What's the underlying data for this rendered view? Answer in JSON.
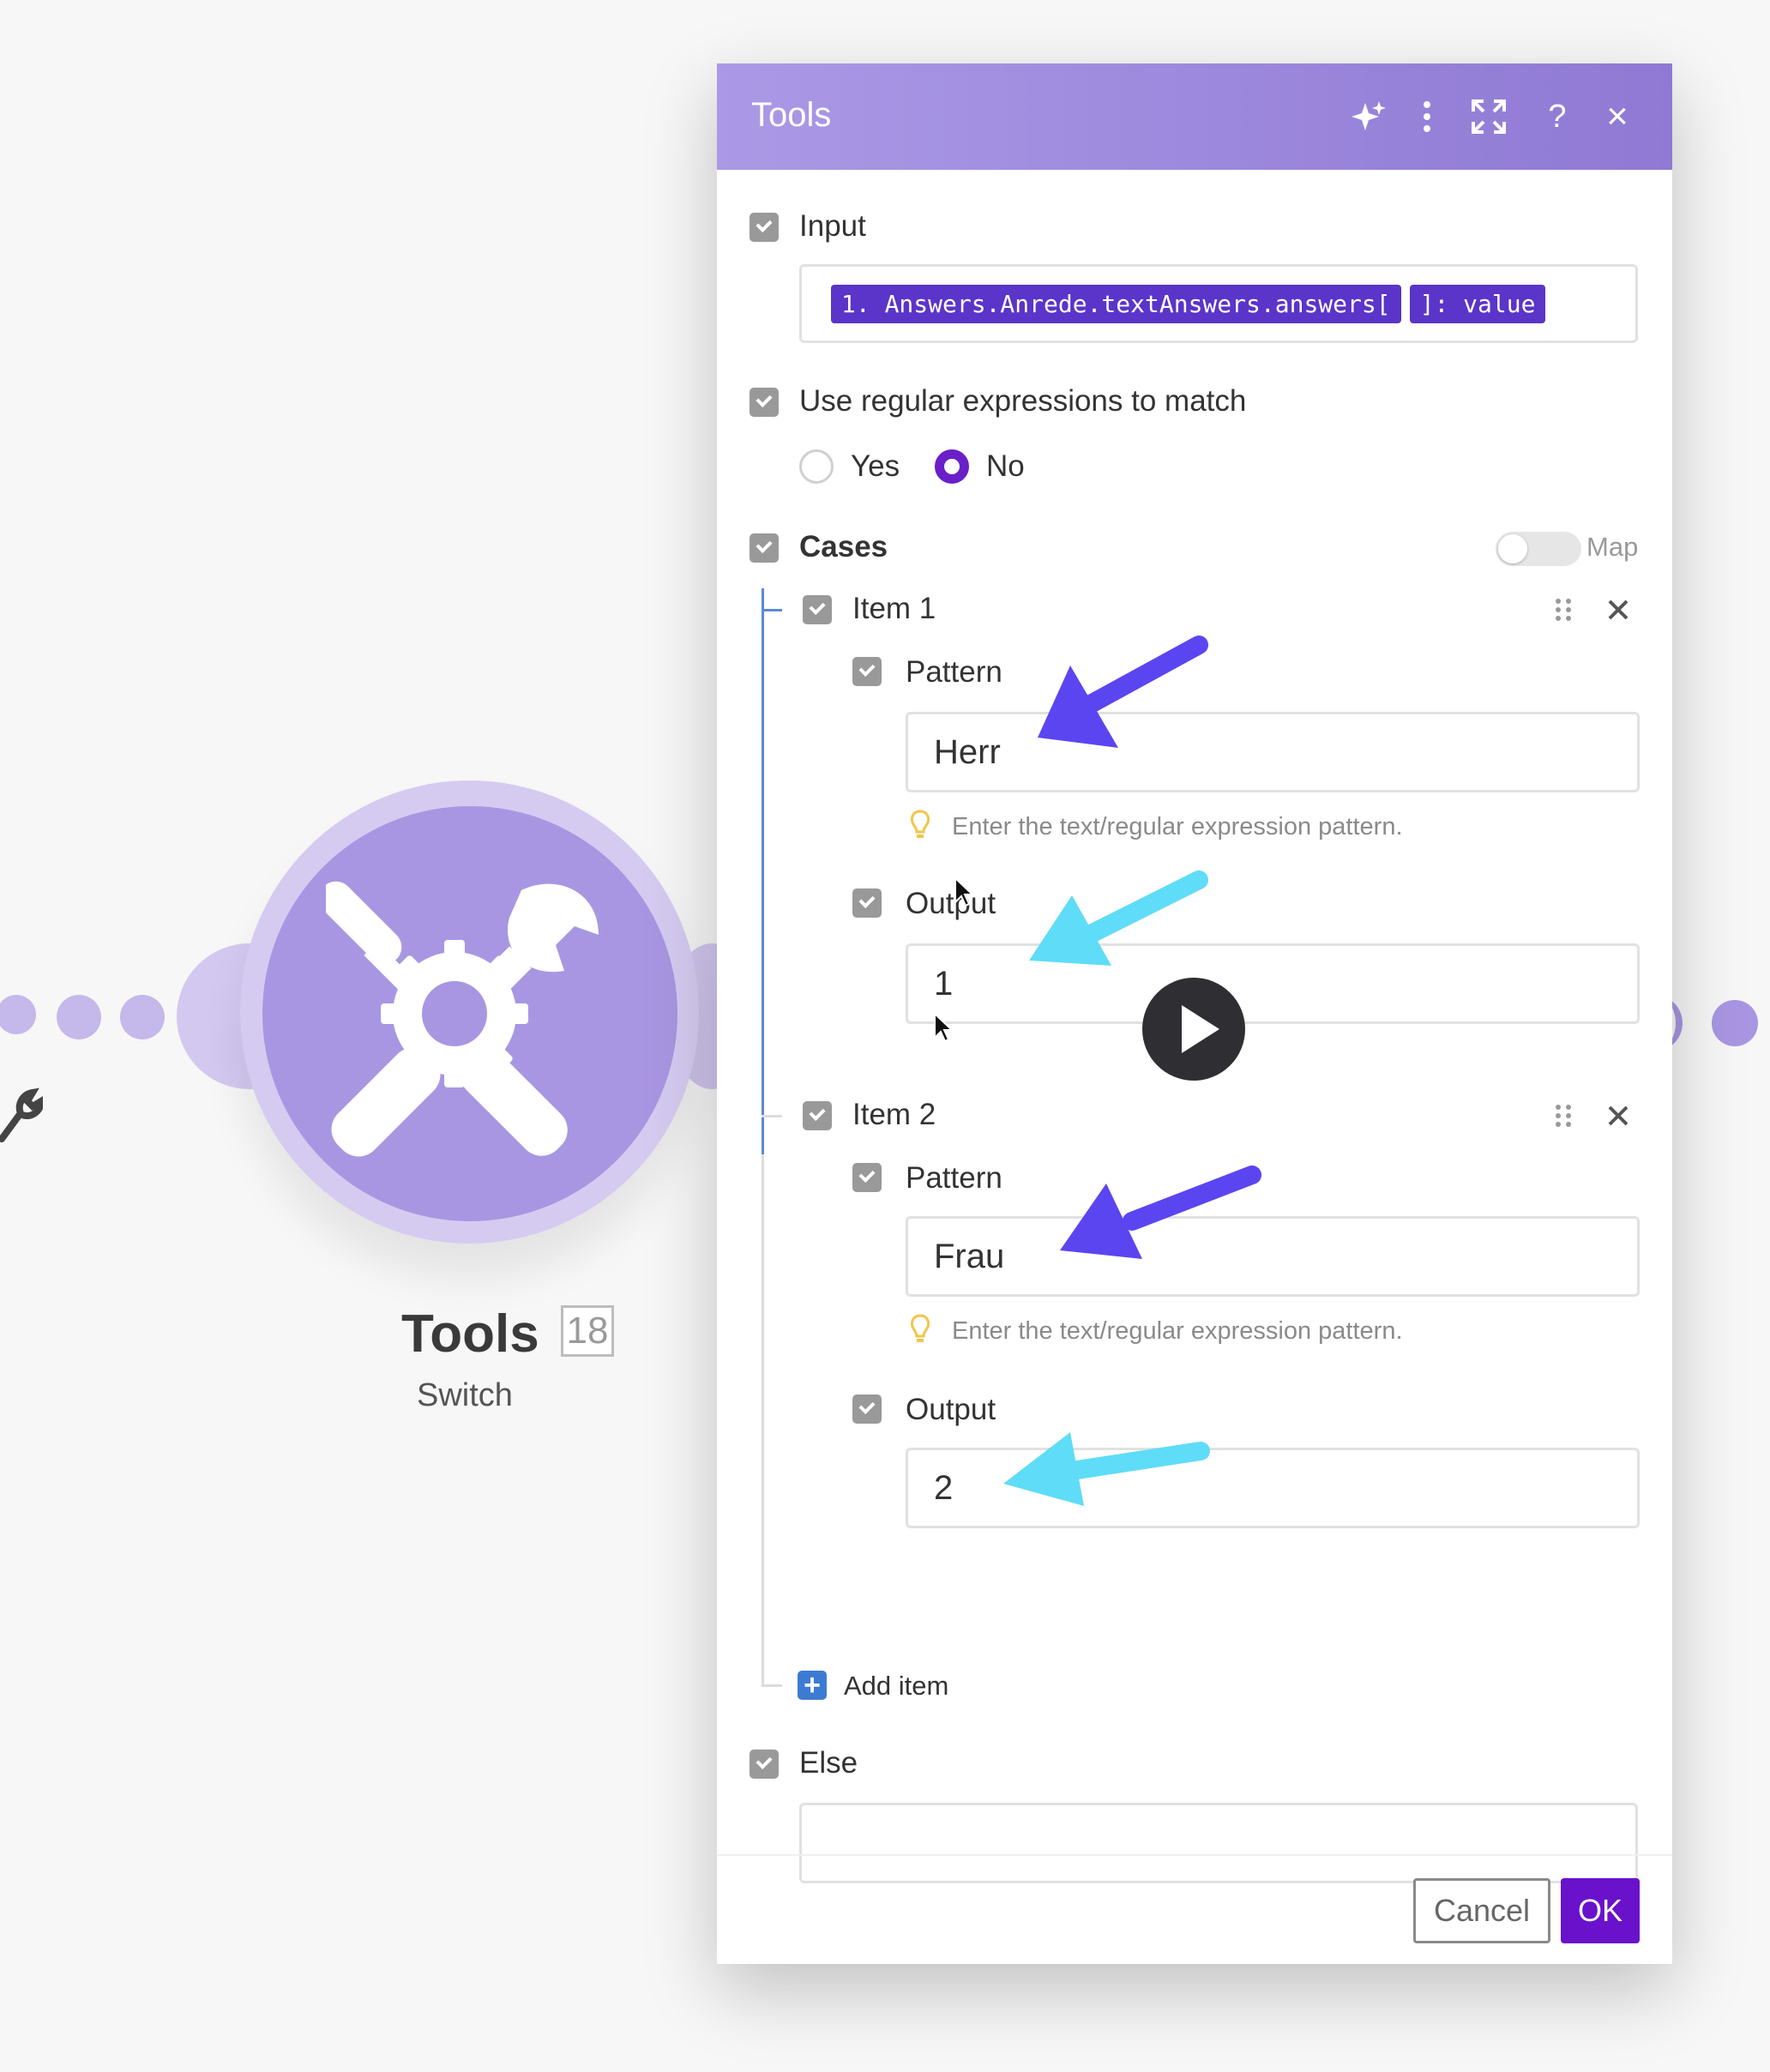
{
  "canvas": {
    "node_title": "Tools",
    "node_badge": "18",
    "node_subtitle": "Switch",
    "node_icon": "tools-icon"
  },
  "dialog": {
    "title": "Tools",
    "header_icons": [
      "sparkle-icon",
      "more-vertical-icon",
      "expand-icon",
      "help-icon",
      "close-icon"
    ],
    "help_glyph": "?",
    "close_glyph": "×",
    "input": {
      "label": "Input",
      "tokens": [
        "1. Answers.Anrede.textAnswers.answers[",
        "]: value"
      ]
    },
    "regex": {
      "label": "Use regular expressions to match",
      "options": [
        {
          "label": "Yes",
          "selected": false
        },
        {
          "label": "No",
          "selected": true
        }
      ]
    },
    "cases": {
      "label": "Cases",
      "map_label": "Map",
      "items": [
        {
          "label": "Item 1",
          "pattern_label": "Pattern",
          "pattern_value": "Herr",
          "pattern_hint": "Enter the text/regular expression pattern.",
          "output_label": "Output",
          "output_value": "1"
        },
        {
          "label": "Item 2",
          "pattern_label": "Pattern",
          "pattern_value": "Frau",
          "pattern_hint": "Enter the text/regular expression pattern.",
          "output_label": "Output",
          "output_value": "2"
        }
      ],
      "add_item_label": "Add item"
    },
    "else": {
      "label": "Else",
      "value": ""
    },
    "buttons": {
      "cancel": "Cancel",
      "ok": "OK"
    }
  },
  "colors": {
    "header_start": "#ab99e6",
    "header_end": "#8f79d4",
    "token_bg": "#5b34c9",
    "radio_selected": "#6a1fc9",
    "ok_button": "#6a11cb",
    "arrow_purple": "#5b45f0",
    "arrow_cyan": "#5fdcf7",
    "node_fill": "#a996e2"
  }
}
